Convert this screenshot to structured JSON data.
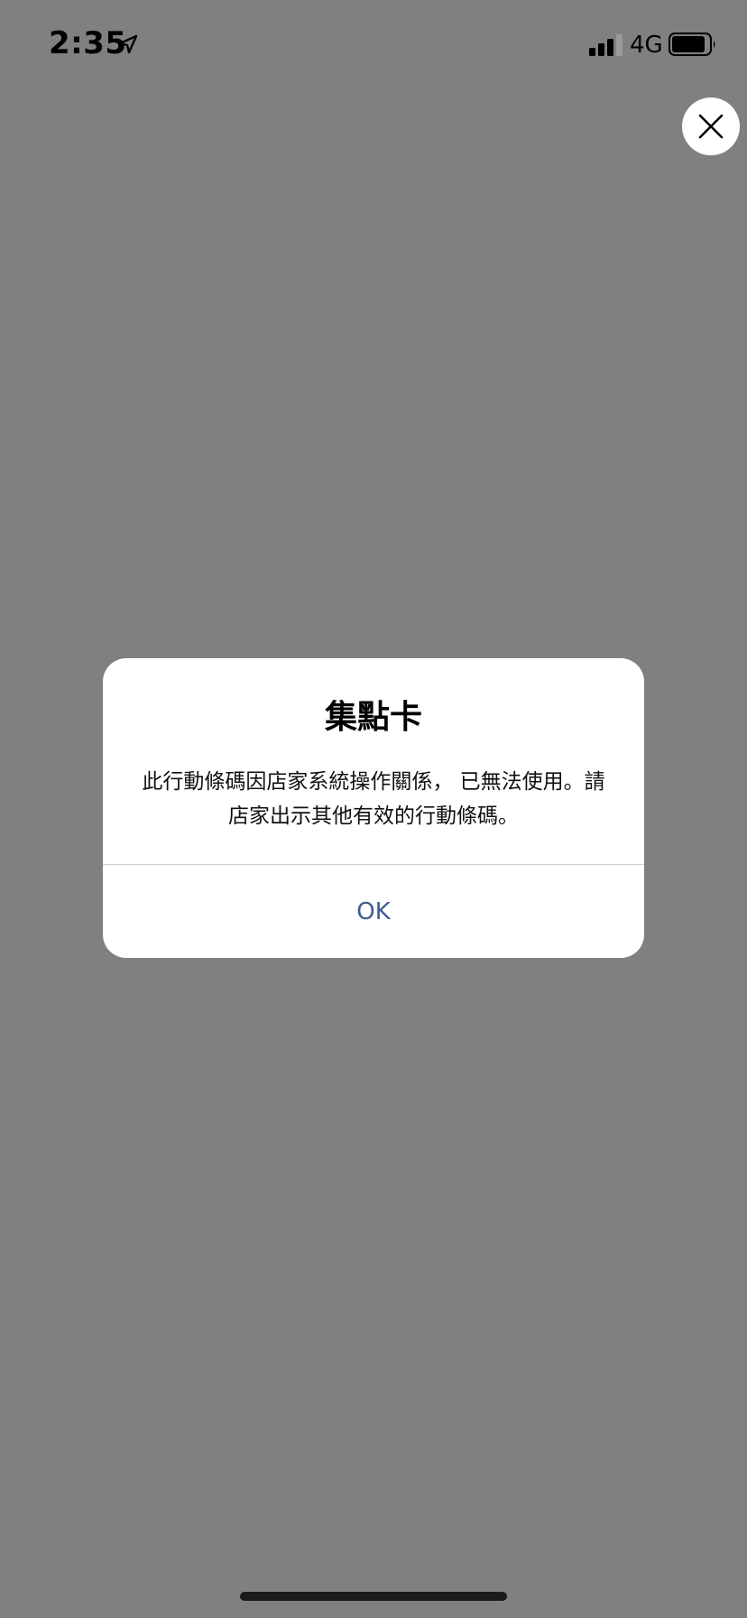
{
  "status_bar": {
    "time": "2:35",
    "network": "4G",
    "icons": {
      "location": "location-arrow-icon",
      "signal": "cellular-signal-icon",
      "battery": "battery-icon"
    }
  },
  "close_button": {
    "icon": "close-icon"
  },
  "dialog": {
    "title": "集點卡",
    "message": "此行動條碼因店家系統操作關係， 已無法使用。請店家出示其他有效的行動條碼。",
    "ok_label": "OK"
  },
  "colors": {
    "background": "#808080",
    "dialog_background": "#ffffff",
    "ok_text": "#3d5d8f"
  }
}
